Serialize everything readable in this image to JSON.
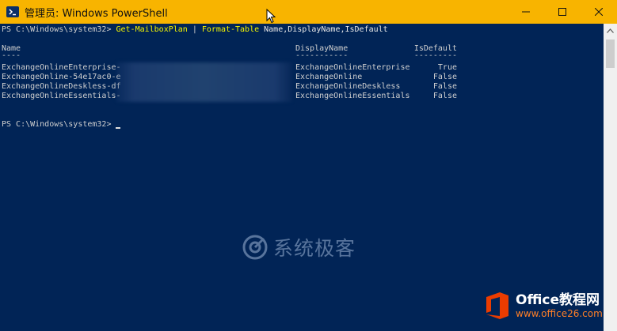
{
  "window": {
    "title": "管理员: Windows PowerShell",
    "icon": "powershell-icon",
    "controls": {
      "minimize": "minimize-icon",
      "maximize": "maximize-icon",
      "close": "close-icon"
    }
  },
  "console": {
    "prompt": "PS C:\\Windows\\system32> ",
    "command": {
      "cmdlet1": "Get-MailboxPlan",
      "pipe": " | ",
      "cmdlet2": "Format-Table",
      "params": " Name,DisplayName,IsDefault"
    },
    "table": {
      "headers": {
        "name": "Name",
        "display": "DisplayName",
        "default": "IsDefault"
      },
      "underlines": {
        "name": "----",
        "display": "-----------",
        "default": "---------"
      },
      "rows": [
        {
          "name": "ExchangeOnlineEnterprise-",
          "display": "ExchangeOnlineEnterprise",
          "default": "True"
        },
        {
          "name": "ExchangeOnline-54e17ac0-e",
          "display": "ExchangeOnline",
          "default": "False"
        },
        {
          "name": "ExchangeOnlineDeskless-df",
          "display": "ExchangeOnlineDeskless",
          "default": "False"
        },
        {
          "name": "ExchangeOnlineEssentials-",
          "display": "ExchangeOnlineEssentials",
          "default": "False"
        }
      ]
    },
    "second_prompt": "PS C:\\Windows\\system32> "
  },
  "watermark": {
    "text": "系统极客",
    "icon": "xitongjike-logo-icon"
  },
  "badge": {
    "brand": "Office教程网",
    "url": "www.office26.com",
    "icon": "office-logo-icon",
    "color": "#eb3c00"
  },
  "colors": {
    "titlebar": "#f8b400",
    "console_bg": "#012456",
    "command": "#f6f600",
    "text": "#cfcfcf"
  }
}
